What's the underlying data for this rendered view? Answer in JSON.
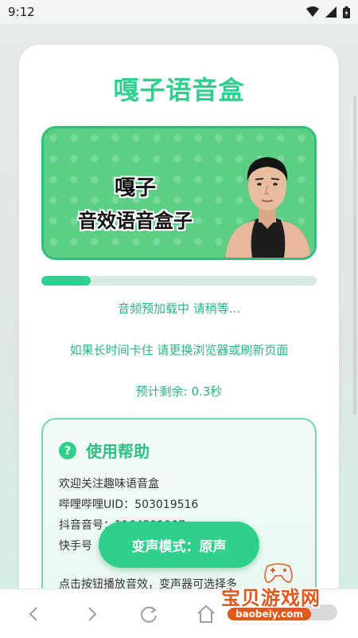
{
  "status_bar": {
    "time": "9:12"
  },
  "app": {
    "title": "嘎子语音盒",
    "banner_line1": "嘎子",
    "banner_line2": "音效语音盒子"
  },
  "loading": {
    "progress": 0.18,
    "status_text": "音频预加载中 请稍等...",
    "hint_text": "如果长时间卡住 请更换浏览器或刷新页面",
    "remaining_text": "预计剩余: 0.3秒"
  },
  "help": {
    "icon_glyph": "?",
    "title": "使用帮助",
    "lines": [
      "欢迎关注趣味语音盒",
      "哔哩哔哩UID：503019516",
      "抖音音号：1164591907",
      "快手号",
      "点击按钮播放音效，变声器可选择多"
    ]
  },
  "voice_mode_button": {
    "label": "变声模式：原声"
  },
  "watermark": {
    "title": "宝贝游戏网",
    "url": "baobeiy.com"
  },
  "colors": {
    "accent": "#2fcf8c",
    "banner_green": "#5ccf85",
    "text_green": "#2db58a"
  },
  "icons": [
    "wifi-icon",
    "signal-icon",
    "battery-icon",
    "back-icon",
    "forward-icon",
    "refresh-icon",
    "home-icon",
    "help-icon"
  ]
}
